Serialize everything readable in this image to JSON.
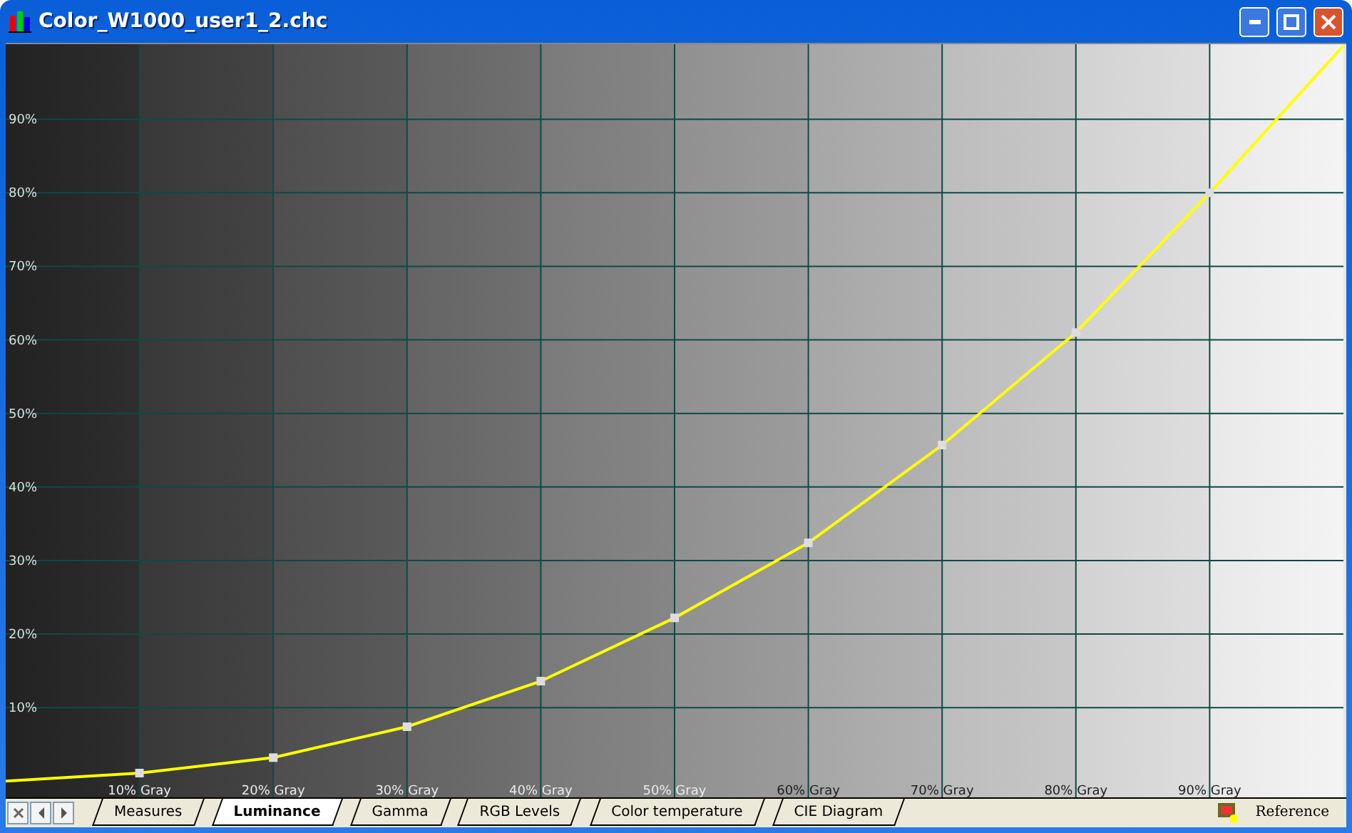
{
  "window": {
    "title": "Color_W1000_user1_2.chc"
  },
  "chart": {
    "chart_data": {
      "type": "line",
      "x": [
        0,
        10,
        20,
        30,
        40,
        50,
        60,
        70,
        80,
        90,
        100
      ],
      "grid": true,
      "series": [
        {
          "color": "#ffff00",
          "marker": "square",
          "values": [
            0,
            1.1,
            3.2,
            7.4,
            13.6,
            22.2,
            32.4,
            45.7,
            61,
            80,
            100
          ]
        }
      ],
      "xlim": [
        0,
        100
      ],
      "ylim": [
        -2.2,
        100
      ],
      "xticks": [
        {
          "value": 10,
          "label": "10% Gray"
        },
        {
          "value": 20,
          "label": "20% Gray"
        },
        {
          "value": 30,
          "label": "30% Gray"
        },
        {
          "value": 40,
          "label": "40% Gray"
        },
        {
          "value": 50,
          "label": "50% Gray"
        },
        {
          "value": 60,
          "label": "60% Gray"
        },
        {
          "value": 70,
          "label": "70% Gray"
        },
        {
          "value": 80,
          "label": "80% Gray"
        },
        {
          "value": 90,
          "label": "90% Gray"
        }
      ],
      "yticks": [
        {
          "value": 10,
          "label": "10%"
        },
        {
          "value": 20,
          "label": "20%"
        },
        {
          "value": 30,
          "label": "30%"
        },
        {
          "value": 40,
          "label": "40%"
        },
        {
          "value": 50,
          "label": "50%"
        },
        {
          "value": 60,
          "label": "60%"
        },
        {
          "value": 70,
          "label": "70%"
        },
        {
          "value": 80,
          "label": "80%"
        },
        {
          "value": 90,
          "label": "90%"
        }
      ]
    }
  },
  "tabs": [
    {
      "label": "Measures",
      "selected": false
    },
    {
      "label": "Luminance",
      "selected": true
    },
    {
      "label": "Gamma",
      "selected": false
    },
    {
      "label": "RGB Levels",
      "selected": false
    },
    {
      "label": "Color temperature",
      "selected": false
    },
    {
      "label": "CIE Diagram",
      "selected": false
    }
  ],
  "reference_button": {
    "label": "Reference"
  }
}
